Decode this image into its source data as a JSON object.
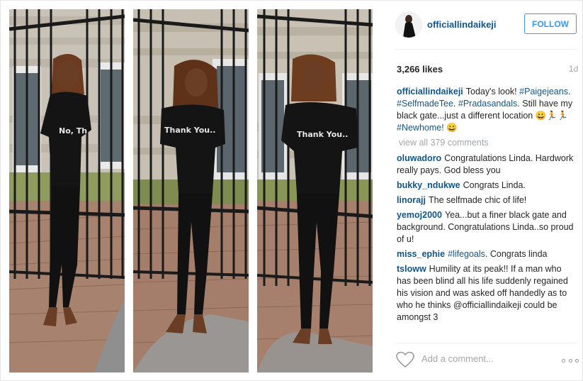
{
  "post": {
    "username": "officiallindaikeji",
    "follow_label": "FOLLOW",
    "likes": "3,266 likes",
    "age": "1d",
    "shirt_text_1": "No, Th",
    "shirt_text_2": "Thank You..",
    "shirt_text_3": "Thank You.."
  },
  "caption": {
    "user": "officiallindaikeji",
    "text_1": "Today's look!",
    "tag_1": "#Paigejeans",
    "sep_1": ". ",
    "tag_2": "#SelfmadeTee",
    "sep_2": ".",
    "tag_3": "#Pradasandals",
    "text_2": ". Still have my black gate...just a different location",
    "emoji_1": "😀🏃🏃",
    "tag_4": "#Newhome!",
    "emoji_2": "😀"
  },
  "view_all": "view all 379 comments",
  "comments": [
    {
      "user": "oluwadoro",
      "text": "Congratulations Linda. Hardwork really pays. God bless you"
    },
    {
      "user": "bukky_ndukwe",
      "text": "Congrats Linda."
    },
    {
      "user": "linorajj",
      "text": "The selfmade chic of life!"
    },
    {
      "user": "yemoj2000",
      "text": "Yea...but a finer black gate and background. Congratulations Linda..so proud of u!"
    },
    {
      "user": "miss_ephie",
      "tag": "#lifegoals",
      "text": ". Congrats linda"
    },
    {
      "user": "tsloww",
      "text": "Humility at its peak!! If a man who has been blind all his life suddenly regained his vision and was asked off handedly as to who he thinks @officiallindaikeji could be amongst 3"
    }
  ],
  "compose": {
    "placeholder": "Add a comment..."
  },
  "icons": {
    "like": "heart-icon",
    "more": "more-options-icon"
  },
  "colors": {
    "username": "#125688",
    "follow": "#3897f0",
    "muted": "#a5a7aa"
  }
}
